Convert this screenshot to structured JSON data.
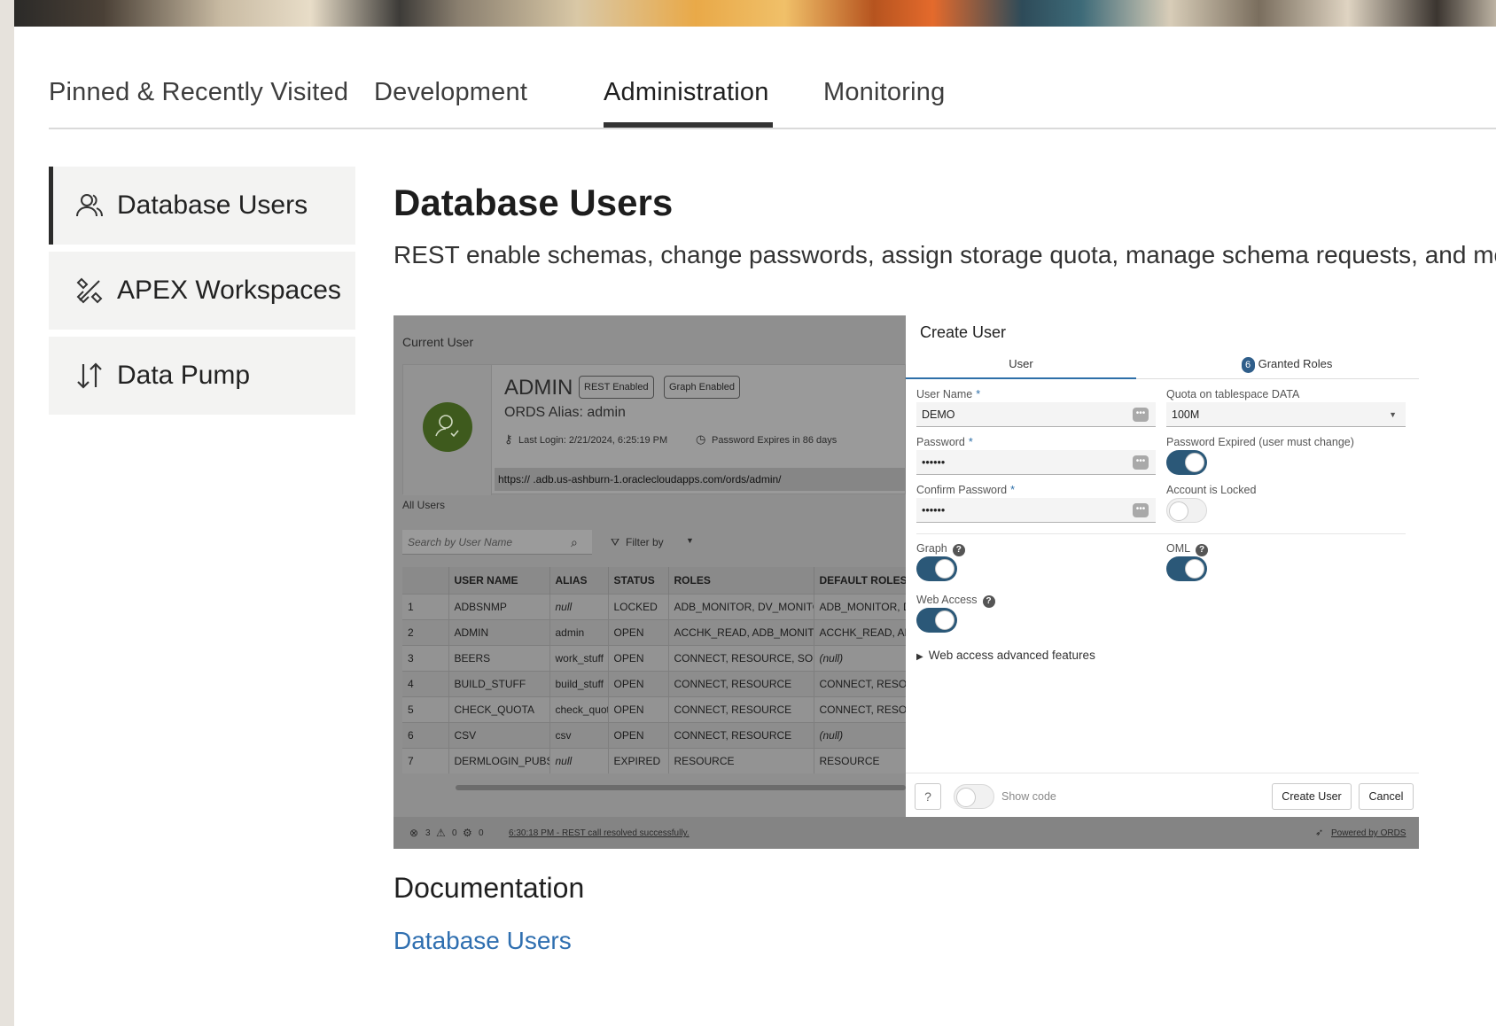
{
  "tabs": [
    {
      "label": "Pinned & Recently Visited"
    },
    {
      "label": "Development"
    },
    {
      "label": "Administration"
    },
    {
      "label": "Monitoring"
    }
  ],
  "active_tab": "Administration",
  "sidebar": {
    "items": [
      {
        "label": "Database Users",
        "icon": "users-icon",
        "active": true
      },
      {
        "label": "APEX Workspaces",
        "icon": "tools-icon",
        "active": false
      },
      {
        "label": "Data Pump",
        "icon": "arrows-up-down-icon",
        "active": false
      }
    ]
  },
  "main": {
    "title": "Database Users",
    "description": "REST enable schemas, change passwords, assign storage quota, manage schema requests, and more."
  },
  "screenshot": {
    "current_user_label": "Current User",
    "user_name": "ADMIN",
    "badges": [
      "REST Enabled",
      "Graph Enabled"
    ],
    "alias": "ORDS Alias: admin",
    "last_login": "Last Login: 2/21/2024, 6:25:19 PM",
    "password_expires": "Password Expires in 86 days",
    "url": "https://                          .adb.us-ashburn-1.oraclecloudapps.com/ords/admin/",
    "all_users_label": "All Users",
    "search_placeholder": "Search by User Name",
    "filter_label": "Filter by",
    "table": {
      "columns": [
        "",
        "USER NAME",
        "ALIAS",
        "STATUS",
        "ROLES",
        "DEFAULT ROLES"
      ],
      "rows": [
        [
          "1",
          "ADBSNMP",
          "null",
          "LOCKED",
          "ADB_MONITOR, DV_MONITOR",
          "ADB_MONITOR, DV_MONITOR"
        ],
        [
          "2",
          "ADMIN",
          "admin",
          "OPEN",
          "ACCHK_READ, ADB_MONITOR",
          "ACCHK_READ, ADB_MONITOR"
        ],
        [
          "3",
          "BEERS",
          "work_stuff",
          "OPEN",
          "CONNECT, RESOURCE, SODA_APP",
          "(null)"
        ],
        [
          "4",
          "BUILD_STUFF",
          "build_stuff",
          "OPEN",
          "CONNECT, RESOURCE",
          "CONNECT, RESOURCE"
        ],
        [
          "5",
          "CHECK_QUOTA",
          "check_quota",
          "OPEN",
          "CONNECT, RESOURCE",
          "CONNECT, RESOURCE"
        ],
        [
          "6",
          "CSV",
          "csv",
          "OPEN",
          "CONNECT, RESOURCE",
          "(null)"
        ],
        [
          "7",
          "DERMLOGIN_PUBS",
          "null",
          "EXPIRED",
          "RESOURCE",
          "RESOURCE"
        ]
      ]
    },
    "status": {
      "errors": "3",
      "warnings": "0",
      "settings": "0",
      "message": "6:30:18 PM - REST call resolved successfully.",
      "powered_by": "Powered by ORDS"
    },
    "dialog": {
      "title": "Create User",
      "tab_user": "User",
      "tab_roles_count": "6",
      "tab_roles": "Granted Roles",
      "user_name_label": "User Name",
      "user_name_value": "DEMO",
      "password_label": "Password",
      "password_value": "••••••",
      "confirm_label": "Confirm Password",
      "confirm_value": "••••••",
      "quota_label": "Quota on tablespace DATA",
      "quota_value": "100M",
      "pw_expired_label": "Password Expired (user must change)",
      "locked_label": "Account is Locked",
      "graph_label": "Graph",
      "oml_label": "OML",
      "web_access_label": "Web Access",
      "advanced_label": "Web access advanced features",
      "show_code_label": "Show code",
      "create_button": "Create User",
      "cancel_button": "Cancel"
    }
  },
  "documentation": {
    "title": "Documentation",
    "link": "Database Users"
  },
  "colors": {
    "accent": "#2e6fa8",
    "toggle_on": "#2b5878",
    "link": "#2f6fb0",
    "avatar": "#3e5a1d"
  }
}
